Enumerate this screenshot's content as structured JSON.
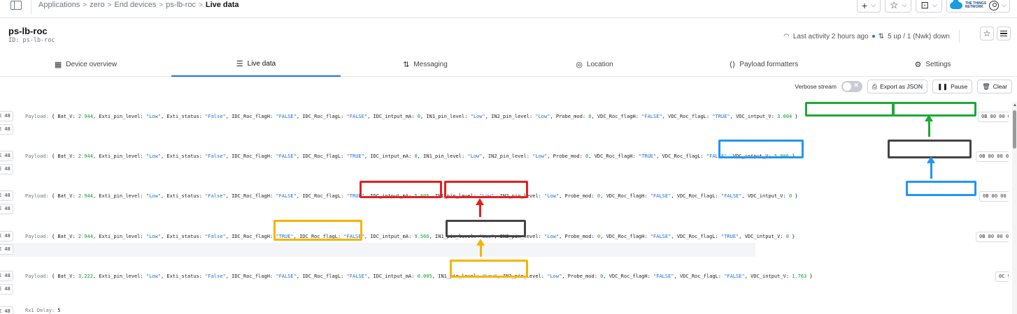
{
  "breadcrumb": {
    "items": [
      "Applications",
      "zero",
      "End devices",
      "ps-lb-roc"
    ],
    "current": "Live data",
    "separator": ">"
  },
  "top_actions": {
    "add": "+",
    "bookmark": "☆",
    "inbox": "⊡",
    "chevron": "⌵"
  },
  "brand": {
    "name_line1": "THE THINGS",
    "name_line2": "NETWORK"
  },
  "device": {
    "name": "ps-lb-roc",
    "id_label": "ID: ps-lb-roc",
    "last_activity": "Last activity 2 hours ago",
    "link_stats": "5 up / 1 (Nwk) down"
  },
  "tabs": [
    {
      "label": "Device overview",
      "icon": "▦"
    },
    {
      "label": "Live data",
      "icon": "☰"
    },
    {
      "label": "Messaging",
      "icon": "⇅"
    },
    {
      "label": "Location",
      "icon": "◎"
    },
    {
      "label": "Payload formatters",
      "icon": "⟨⟩"
    },
    {
      "label": "Settings",
      "icon": "⚙"
    }
  ],
  "toolbar": {
    "verbose_label": "Verbose stream",
    "verbose_on": false,
    "export_label": "Export as JSON",
    "pause_label": "Pause",
    "clear_label": "Clear"
  },
  "hex_fragment": "E 48",
  "payload_label": "Payload:",
  "rows": [
    {
      "hex_tail": "0B 80 00 0",
      "fields": [
        {
          "k": "Bat_V",
          "v": "2.944",
          "t": "num"
        },
        {
          "k": "Exti_pin_level",
          "v": "\"Low\"",
          "t": "str"
        },
        {
          "k": "Exti_status",
          "v": "\"False\"",
          "t": "str"
        },
        {
          "k": "IDC_Roc_flagH",
          "v": "\"FALSE\"",
          "t": "str"
        },
        {
          "k": "IDC_Roc_flagL",
          "v": "\"FALSE\"",
          "t": "str"
        },
        {
          "k": "IDC_intput_mA",
          "v": "0",
          "t": "num"
        },
        {
          "k": "IN1_pin_level",
          "v": "\"Low\"",
          "t": "str"
        },
        {
          "k": "IN2_pin_level",
          "v": "\"Low\"",
          "t": "str"
        },
        {
          "k": "Probe_mod",
          "v": "0",
          "t": "num"
        },
        {
          "k": "VDC_Roc_flagH",
          "v": "\"FALSE\"",
          "t": "str"
        },
        {
          "k": "VDC_Roc_flagL",
          "v": "\"TRUE\"",
          "t": "str"
        },
        {
          "k": "VDC_intput_V",
          "v": "3.004",
          "t": "num"
        }
      ]
    },
    {
      "hex_tail": "0B 80 00 0",
      "fields": [
        {
          "k": "Bat_V",
          "v": "2.944",
          "t": "num"
        },
        {
          "k": "Exti_pin_level",
          "v": "\"Low\"",
          "t": "str"
        },
        {
          "k": "Exti_status",
          "v": "\"False\"",
          "t": "str"
        },
        {
          "k": "IDC_Roc_flagH",
          "v": "\"FALSE\"",
          "t": "str"
        },
        {
          "k": "IDC_Roc_flagL",
          "v": "\"TRUE\"",
          "t": "str"
        },
        {
          "k": "IDC_intput_mA",
          "v": "0",
          "t": "num"
        },
        {
          "k": "IN1_pin_level",
          "v": "\"Low\"",
          "t": "str"
        },
        {
          "k": "IN2_pin_level",
          "v": "\"Low\"",
          "t": "str"
        },
        {
          "k": "Probe_mod",
          "v": "0",
          "t": "num"
        },
        {
          "k": "VDC_Roc_flagH",
          "v": "\"TRUE\"",
          "t": "str"
        },
        {
          "k": "VDC_Roc_flagL",
          "v": "\"FALSE\"",
          "t": "str"
        },
        {
          "k": "VDC_intput_V",
          "v": "5.006",
          "t": "num"
        }
      ]
    },
    {
      "hex_tail": "0B 80 00 0",
      "fields": [
        {
          "k": "Bat_V",
          "v": "2.944",
          "t": "num"
        },
        {
          "k": "Exti_pin_level",
          "v": "\"Low\"",
          "t": "str"
        },
        {
          "k": "Exti_status",
          "v": "\"False\"",
          "t": "str"
        },
        {
          "k": "IDC_Roc_flagH",
          "v": "\"FALSE\"",
          "t": "str"
        },
        {
          "k": "IDC_Roc_flagL",
          "v": "\"TRUE\"",
          "t": "str"
        },
        {
          "k": "IDC_intput_mA",
          "v": "5.605",
          "t": "num"
        },
        {
          "k": "IN1_pin_level",
          "v": "\"Low\"",
          "t": "str"
        },
        {
          "k": "IN2_pin_level",
          "v": "\"Low\"",
          "t": "str"
        },
        {
          "k": "Probe_mod",
          "v": "0",
          "t": "num"
        },
        {
          "k": "VDC_Roc_flagH",
          "v": "\"FALSE\"",
          "t": "str"
        },
        {
          "k": "VDC_Roc_flagL",
          "v": "\"FALSE\"",
          "t": "str"
        },
        {
          "k": "VDC_intput_V",
          "v": "0",
          "t": "num"
        }
      ]
    },
    {
      "hex_tail": "0B 80 00 0",
      "fields": [
        {
          "k": "Bat_V",
          "v": "2.944",
          "t": "num"
        },
        {
          "k": "Exti_pin_level",
          "v": "\"Low\"",
          "t": "str"
        },
        {
          "k": "Exti_status",
          "v": "\"False\"",
          "t": "str"
        },
        {
          "k": "IDC_Roc_flagH",
          "v": "\"TRUE\"",
          "t": "str"
        },
        {
          "k": "IDC_Roc_flagL",
          "v": "\"FALSE\"",
          "t": "str"
        },
        {
          "k": "IDC_intput_mA",
          "v": "9.566",
          "t": "num"
        },
        {
          "k": "IN1_pin_level",
          "v": "\"Low\"",
          "t": "str"
        },
        {
          "k": "IN2_pin_level",
          "v": "\"Low\"",
          "t": "str"
        },
        {
          "k": "Probe_mod",
          "v": "0",
          "t": "num"
        },
        {
          "k": "VDC_Roc_flagH",
          "v": "\"FALSE\"",
          "t": "str"
        },
        {
          "k": "VDC_Roc_flagL",
          "v": "\"TRUE\"",
          "t": "str"
        },
        {
          "k": "VDC_intput_V",
          "v": "0",
          "t": "num"
        }
      ]
    },
    {
      "hex_tail": "0C 9",
      "fields": [
        {
          "k": "Bat_V",
          "v": "3.222",
          "t": "num"
        },
        {
          "k": "Exti_pin_level",
          "v": "\"Low\"",
          "t": "str"
        },
        {
          "k": "Exti_status",
          "v": "\"False\"",
          "t": "str"
        },
        {
          "k": "IDC_Roc_flagH",
          "v": "\"FALSE\"",
          "t": "str"
        },
        {
          "k": "IDC_Roc_flagL",
          "v": "\"FALSE\"",
          "t": "str"
        },
        {
          "k": "IDC_intput_mA",
          "v": "0.005",
          "t": "num"
        },
        {
          "k": "IN1_pin_level",
          "v": "\"Low\"",
          "t": "str"
        },
        {
          "k": "IN2_pin_level",
          "v": "\"Low\"",
          "t": "str"
        },
        {
          "k": "Probe_mod",
          "v": "0",
          "t": "num"
        },
        {
          "k": "VDC_Roc_flagH",
          "v": "\"FALSE\"",
          "t": "str"
        },
        {
          "k": "VDC_Roc_flagL",
          "v": "\"FALSE\"",
          "t": "str"
        },
        {
          "k": "VDC_intput_V",
          "v": "1.763",
          "t": "num"
        }
      ]
    }
  ],
  "rx_delay_label": "Rx1 Delay:",
  "rx_delay_value": "5",
  "colors": {
    "accent": "#1a73e8",
    "annotation_green": "#1fa838",
    "annotation_blue": "#2196f3",
    "annotation_dark": "#444444",
    "annotation_red": "#e02020",
    "annotation_orange": "#f5b400"
  }
}
